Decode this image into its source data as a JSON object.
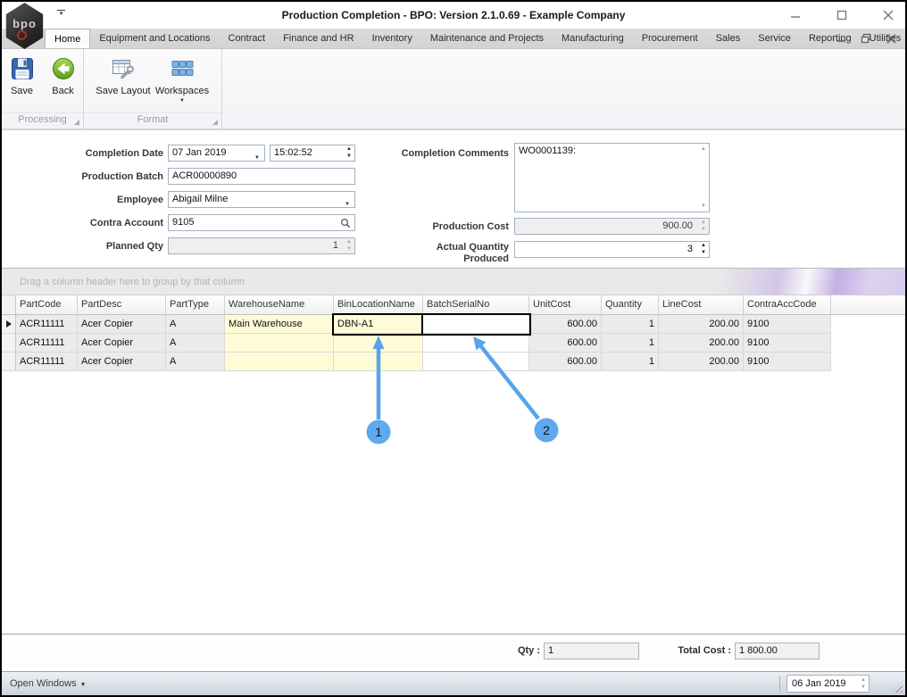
{
  "window": {
    "title": "Production Completion - BPO: Version 2.1.0.69 - Example Company",
    "logo_text": "bpo"
  },
  "ribbon": {
    "tabs": [
      {
        "label": "Home",
        "active": true
      },
      {
        "label": "Equipment and Locations"
      },
      {
        "label": "Contract"
      },
      {
        "label": "Finance and HR"
      },
      {
        "label": "Inventory"
      },
      {
        "label": "Maintenance and Projects"
      },
      {
        "label": "Manufacturing"
      },
      {
        "label": "Procurement"
      },
      {
        "label": "Sales"
      },
      {
        "label": "Service"
      },
      {
        "label": "Reporting"
      },
      {
        "label": "Utilities"
      }
    ],
    "groups": [
      {
        "caption": "Processing",
        "buttons": [
          {
            "label": "Save",
            "icon": "save-floppy-icon"
          },
          {
            "label": "Back",
            "icon": "back-arrow-icon"
          }
        ]
      },
      {
        "caption": "Format",
        "buttons": [
          {
            "label": "Save Layout",
            "icon": "save-layout-icon"
          },
          {
            "label": "Workspaces",
            "icon": "workspaces-grid-icon",
            "has_dropdown": true
          }
        ]
      }
    ]
  },
  "form": {
    "completion_date": {
      "label": "Completion Date",
      "date": "07 Jan 2019",
      "time": "15:02:52"
    },
    "production_batch": {
      "label": "Production Batch",
      "value": "ACR00000890"
    },
    "employee": {
      "label": "Employee",
      "value": "Abigail Milne"
    },
    "contra_account": {
      "label": "Contra Account",
      "value": "9105"
    },
    "planned_qty": {
      "label": "Planned Qty",
      "value": "1"
    },
    "completion_comments": {
      "label": "Completion Comments",
      "value": "WO0001139:"
    },
    "production_cost": {
      "label": "Production Cost",
      "value": "900.00"
    },
    "actual_quantity": {
      "label": "Actual Quantity Produced",
      "value": "3"
    }
  },
  "grid": {
    "group_panel_text": "Drag a column header here to group by that column",
    "columns": [
      "PartCode",
      "PartDesc",
      "PartType",
      "WarehouseName",
      "BinLocationName",
      "BatchSerialNo",
      "UnitCost",
      "Quantity",
      "LineCost",
      "ContraAccCode"
    ],
    "rows": [
      {
        "current": true,
        "cells": [
          "ACR11111",
          "Acer Copier",
          "A",
          "Main Warehouse",
          "DBN-A1",
          "",
          "600.00",
          "1",
          "200.00",
          "9100"
        ]
      },
      {
        "current": false,
        "cells": [
          "ACR11111",
          "Acer Copier",
          "A",
          "",
          "",
          "",
          "600.00",
          "1",
          "200.00",
          "9100"
        ]
      },
      {
        "current": false,
        "cells": [
          "ACR11111",
          "Acer Copier",
          "A",
          "",
          "",
          "",
          "600.00",
          "1",
          "200.00",
          "9100"
        ]
      }
    ],
    "selected_cells": [
      {
        "row": 0,
        "col": 4
      },
      {
        "row": 0,
        "col": 5
      }
    ]
  },
  "callouts": [
    {
      "number": "1"
    },
    {
      "number": "2"
    }
  ],
  "summary": {
    "qty_label": "Qty :",
    "qty_value": "1",
    "total_label": "Total Cost :",
    "total_value": "1 800.00"
  },
  "statusbar": {
    "open_windows_label": "Open Windows",
    "date_value": "06 Jan 2019"
  },
  "colors": {
    "callout_blue": "#58a4ec",
    "editable_cell_yellow": "#fffbd6",
    "selected_cell_border": "#000000"
  }
}
